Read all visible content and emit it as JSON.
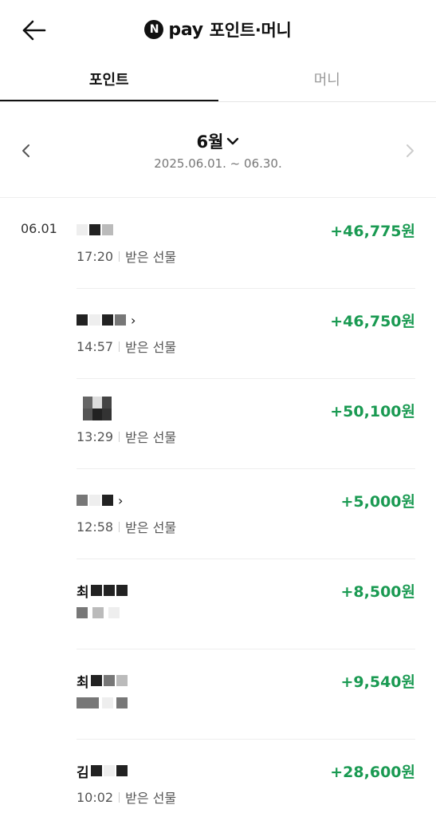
{
  "header": {
    "logo_letter": "N",
    "pay_word": "pay",
    "title": "포인트·머니"
  },
  "tabs": [
    {
      "label": "포인트",
      "active": true
    },
    {
      "label": "머니",
      "active": false
    }
  ],
  "month": {
    "label": "6월",
    "range": "2025.06.01. ~ 06.30."
  },
  "transactions": [
    {
      "date": "06.01",
      "time": "17:20",
      "type": "받은 선물",
      "amount": "+46,775원"
    },
    {
      "date": "",
      "time": "14:57",
      "type": "받은 선물",
      "amount": "+46,750원"
    },
    {
      "date": "",
      "time": "13:29",
      "type": "받은 선물",
      "amount": "+50,100원"
    },
    {
      "date": "",
      "time": "12:58",
      "type": "받은 선물",
      "amount": "+5,000원"
    },
    {
      "date": "",
      "name_initial": "최",
      "time": "",
      "type": "",
      "amount": "+8,500원"
    },
    {
      "date": "",
      "name_initial": "최",
      "time": "",
      "type": "",
      "amount": "+9,540원"
    },
    {
      "date": "",
      "name_initial": "김",
      "time": "10:02",
      "type": "받은 선물",
      "amount": "+28,600원"
    }
  ],
  "colors": {
    "amount_green": "#1a9a52"
  }
}
